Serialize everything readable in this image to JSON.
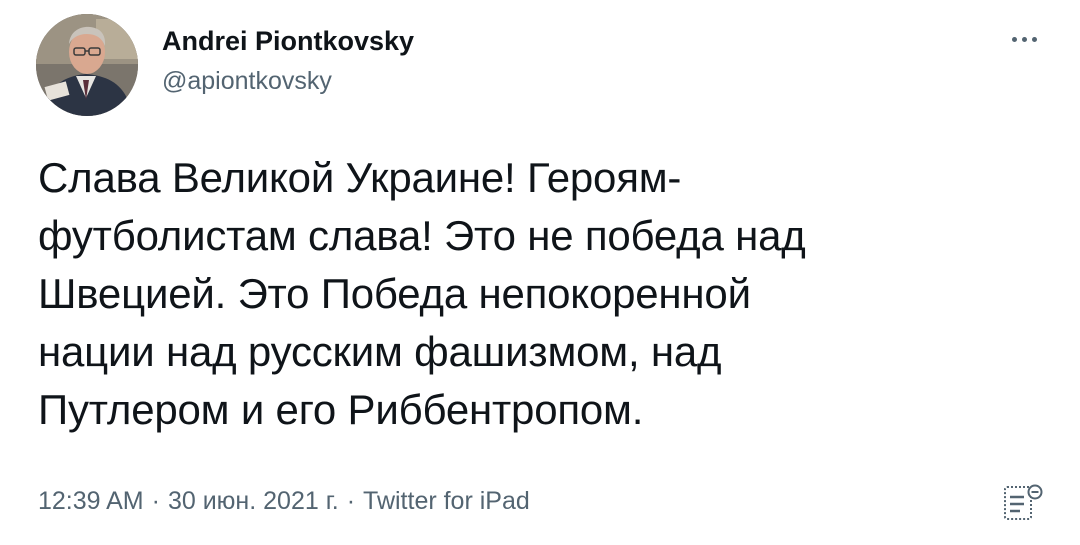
{
  "author": {
    "display_name": "Andrei Piontkovsky",
    "handle": "@apiontkovsky"
  },
  "tweet": {
    "lines": [
      "Слава Великой Украине! Героям-",
      "футболистам слава! Это не победа над",
      "Швецией. Это Победа непокоренной",
      "нации над русским фашизмом, над",
      "Путлером и его Риббентропом."
    ]
  },
  "meta": {
    "time": "12:39 AM",
    "separator": "·",
    "date": "30 июн. 2021 г.",
    "source": "Twitter for iPad"
  },
  "icons": {
    "more": "more-horizontal-icon",
    "analytics": "analytics-icon"
  },
  "colors": {
    "text": "#0f1419",
    "secondary": "#536471",
    "background": "#ffffff"
  }
}
